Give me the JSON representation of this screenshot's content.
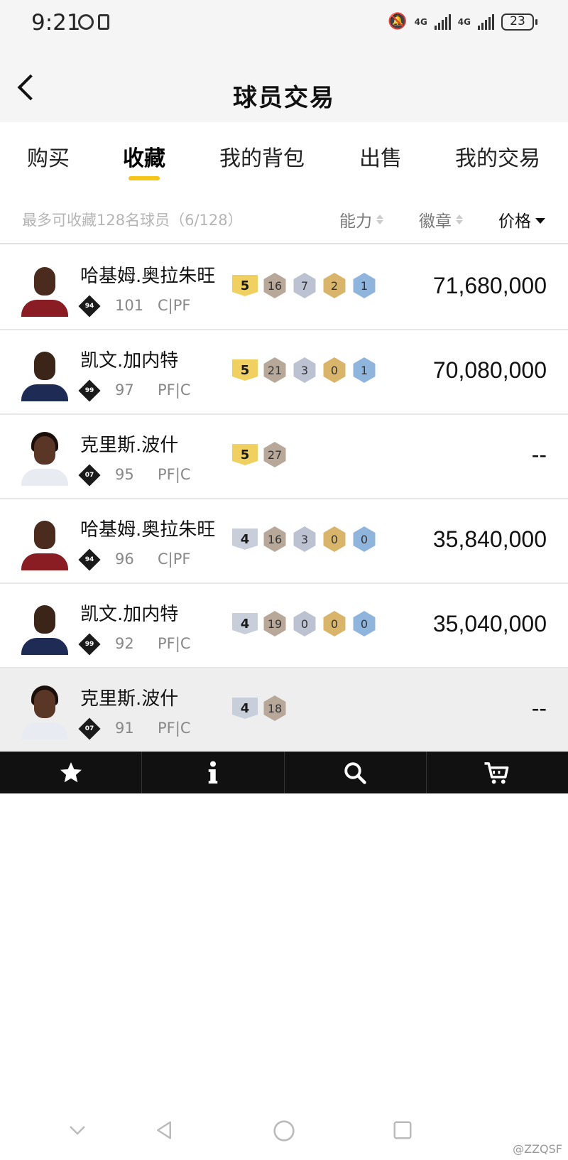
{
  "status_bar": {
    "time": "9:21",
    "network": "4G",
    "battery": "23"
  },
  "header": {
    "title": "球员交易"
  },
  "tabs": [
    {
      "label": "购买"
    },
    {
      "label": "收藏"
    },
    {
      "label": "我的背包"
    },
    {
      "label": "出售"
    },
    {
      "label": "我的交易"
    }
  ],
  "filter": {
    "capacity_text": "最多可收藏128名球员（6/128）",
    "sort_ability": "能力",
    "sort_badge": "徽章",
    "sort_price": "价格"
  },
  "players": [
    {
      "name": "哈基姆.奥拉朱旺",
      "card": "94",
      "ovr": "101",
      "pos": "C|PF",
      "level": "5",
      "badges": [
        "16",
        "7",
        "2",
        "1"
      ],
      "price": "71,680,000"
    },
    {
      "name": "凯文.加内特",
      "card": "99",
      "ovr": "97",
      "pos": "PF|C",
      "level": "5",
      "badges": [
        "21",
        "3",
        "0",
        "1"
      ],
      "price": "70,080,000"
    },
    {
      "name": "克里斯.波什",
      "card": "07",
      "ovr": "95",
      "pos": "PF|C",
      "level": "5",
      "badges": [
        "27"
      ],
      "price": "--"
    },
    {
      "name": "哈基姆.奥拉朱旺",
      "card": "94",
      "ovr": "96",
      "pos": "C|PF",
      "level": "4",
      "badges": [
        "16",
        "3",
        "0",
        "0"
      ],
      "price": "35,840,000"
    },
    {
      "name": "凯文.加内特",
      "card": "99",
      "ovr": "92",
      "pos": "PF|C",
      "level": "4",
      "badges": [
        "19",
        "0",
        "0",
        "0"
      ],
      "price": "35,040,000"
    },
    {
      "name": "克里斯.波什",
      "card": "07",
      "ovr": "91",
      "pos": "PF|C",
      "level": "4",
      "badges": [
        "18"
      ],
      "price": "--"
    }
  ],
  "toolbar": {
    "favorite": "star-icon",
    "info": "info-icon",
    "search": "search-icon",
    "cart": "cart-icon"
  },
  "watermark": "@ZZQSF",
  "colors": {
    "accent": "#f5c518",
    "toolbar_bg": "#111111"
  }
}
